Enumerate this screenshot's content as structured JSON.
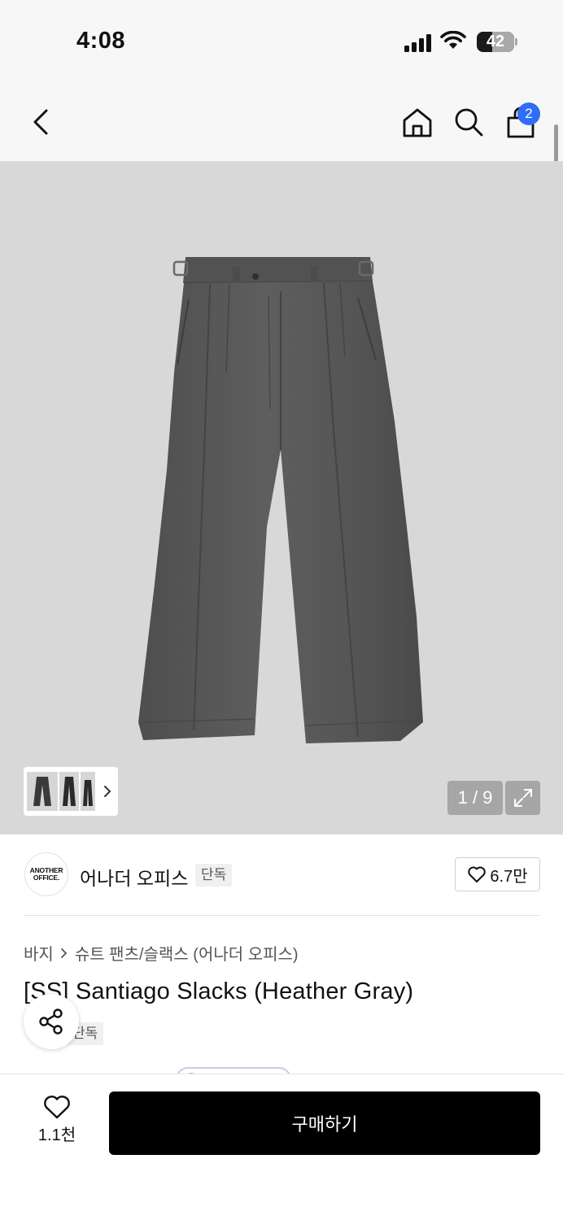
{
  "status_bar": {
    "time": "4:08",
    "battery_level": "42",
    "icons": [
      "signal-icon",
      "wifi-icon",
      "battery-icon"
    ]
  },
  "nav": {
    "icons": [
      "back-icon",
      "home-icon",
      "search-icon",
      "cart-icon"
    ],
    "cart_count": "2"
  },
  "gallery": {
    "counter": "1 / 9",
    "background_color": "#d8d8d9"
  },
  "brand": {
    "logo_line1": "ANOTHER",
    "logo_line2": "OFFICE.",
    "name": "어나더 오피스",
    "exclusive_badge": "단독",
    "likes": "6.7만"
  },
  "product": {
    "breadcrumb": [
      "바지",
      "슈트 팬츠/슬랙스 (어나더 오피스)"
    ],
    "title": "[SS] Santiago Slacks (Heather Gray)",
    "badge": "단독"
  },
  "bottom_bar": {
    "wish_count": "1.1천",
    "buy_label": "구매하기",
    "buy_color": "#000000"
  },
  "colors": {
    "badge_blue": "#2f6df6",
    "pants_gray": "#5a5a5b"
  }
}
